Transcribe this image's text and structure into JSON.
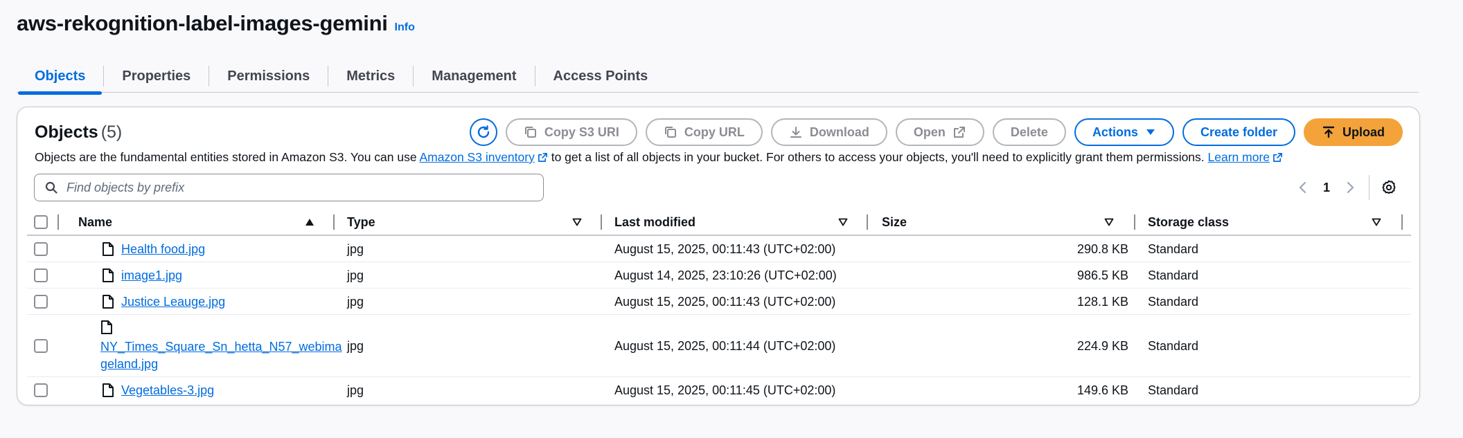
{
  "header": {
    "bucket_name": "aws-rekognition-label-images-gemini",
    "info_label": "Info"
  },
  "tabs": [
    {
      "label": "Objects",
      "active": true
    },
    {
      "label": "Properties",
      "active": false
    },
    {
      "label": "Permissions",
      "active": false
    },
    {
      "label": "Metrics",
      "active": false
    },
    {
      "label": "Management",
      "active": false
    },
    {
      "label": "Access Points",
      "active": false
    }
  ],
  "objects_panel": {
    "title": "Objects",
    "count": "(5)",
    "description_before": "Objects are the fundamental entities stored in Amazon S3. You can use ",
    "inventory_link": "Amazon S3 inventory",
    "description_middle": " to get a list of all objects in your bucket. For others to access your objects, you'll need to explicitly grant them permissions. ",
    "learn_more_link": "Learn more"
  },
  "toolbar": {
    "copy_s3_uri": "Copy S3 URI",
    "copy_url": "Copy URL",
    "download": "Download",
    "open": "Open",
    "delete": "Delete",
    "actions": "Actions",
    "create_folder": "Create folder",
    "upload": "Upload"
  },
  "search": {
    "placeholder": "Find objects by prefix",
    "value": ""
  },
  "pagination": {
    "current_page": "1"
  },
  "table": {
    "columns": [
      "Name",
      "Type",
      "Last modified",
      "Size",
      "Storage class"
    ],
    "rows": [
      {
        "name": "Health food.jpg",
        "type": "jpg",
        "last_modified": "August 15, 2025, 00:11:43 (UTC+02:00)",
        "size": "290.8 KB",
        "storage_class": "Standard"
      },
      {
        "name": "image1.jpg",
        "type": "jpg",
        "last_modified": "August 14, 2025, 23:10:26 (UTC+02:00)",
        "size": "986.5 KB",
        "storage_class": "Standard"
      },
      {
        "name": "Justice Leauge.jpg",
        "type": "jpg",
        "last_modified": "August 15, 2025, 00:11:43 (UTC+02:00)",
        "size": "128.1 KB",
        "storage_class": "Standard"
      },
      {
        "name_line1": "NY_Times_Square_Sn_hetta_N57_webima",
        "name_line2": "geland.jpg",
        "type": "jpg",
        "last_modified": "August 15, 2025, 00:11:44 (UTC+02:00)",
        "size": "224.9 KB",
        "storage_class": "Standard"
      },
      {
        "name": "Vegetables-3.jpg",
        "type": "jpg",
        "last_modified": "August 15, 2025, 00:11:45 (UTC+02:00)",
        "size": "149.6 KB",
        "storage_class": "Standard"
      }
    ]
  },
  "colors": {
    "accent": "#006ce0",
    "primary_button": "#f3a33a",
    "text": "#0f141a",
    "border": "#c6c6cd"
  }
}
